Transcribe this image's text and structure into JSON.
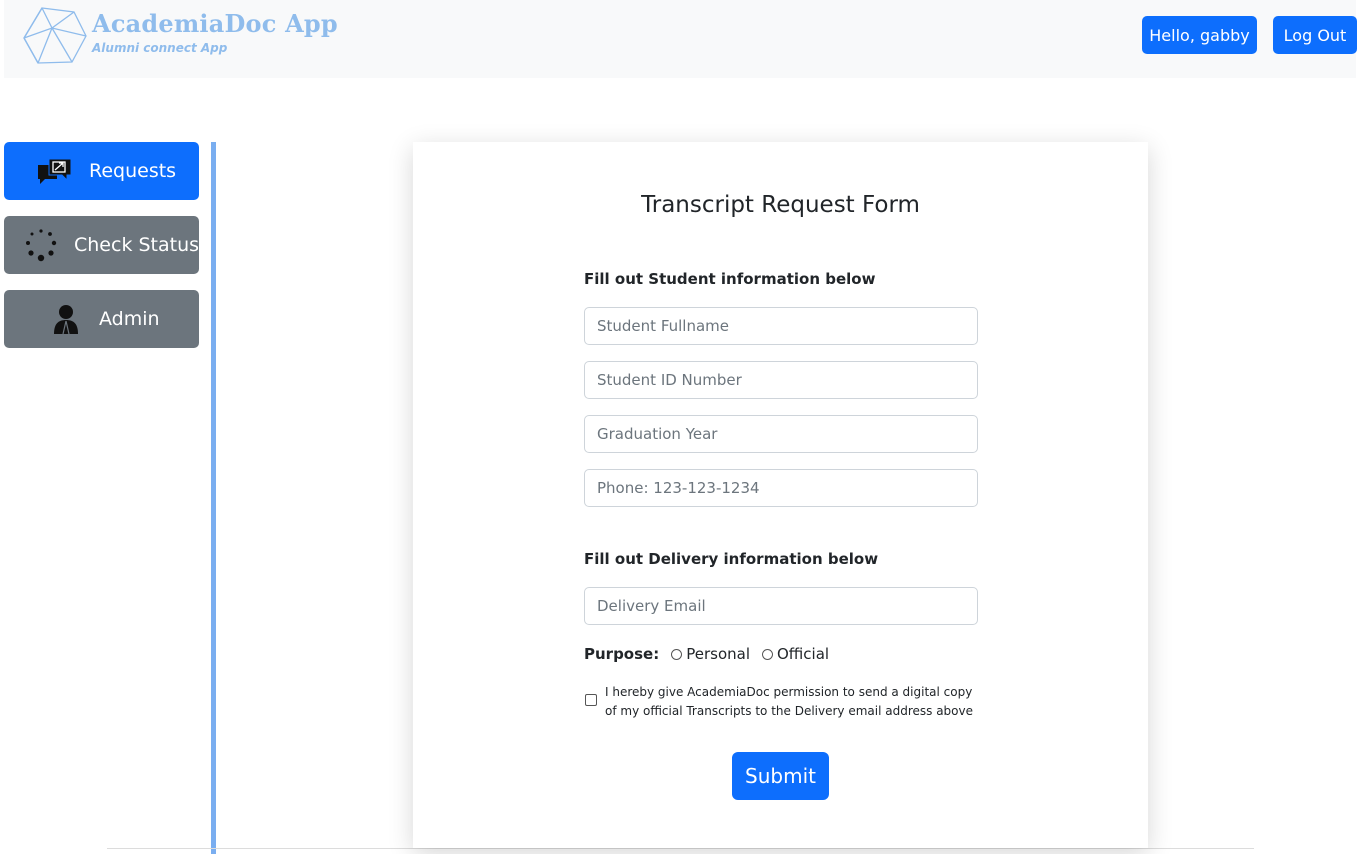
{
  "brand": {
    "title": "AcademiaDoc App",
    "subtitle": "Alumni connect App"
  },
  "header": {
    "greeting_button": "Hello, gabby",
    "logout_button": "Log Out"
  },
  "sidebar": {
    "items": [
      {
        "label": "Requests",
        "icon": "chat-request-icon",
        "active": true
      },
      {
        "label": "Check Status",
        "icon": "loading-spinner-icon",
        "active": false
      },
      {
        "label": "Admin",
        "icon": "user-icon",
        "active": false
      }
    ]
  },
  "form": {
    "title": "Transcript Request Form",
    "student_section": "Fill out Student information below",
    "fields": {
      "fullname_placeholder": "Student Fullname",
      "id_placeholder": "Student ID Number",
      "grad_year_placeholder": "Graduation Year",
      "phone_placeholder": "Phone: 123-123-1234"
    },
    "delivery_section": "Fill out Delivery information below",
    "delivery_email_placeholder": "Delivery Email",
    "purpose": {
      "label": "Purpose:",
      "options": [
        "Personal",
        "Official"
      ]
    },
    "consent_text": "I hereby give AcademiaDoc permission to send a digital copy of my official Transcripts to the Delivery email address above",
    "submit_label": "Submit"
  },
  "colors": {
    "primary": "#0d6efd",
    "secondary": "#6c757d",
    "brand": "#8fbcec",
    "divider": "#7aaef0"
  }
}
